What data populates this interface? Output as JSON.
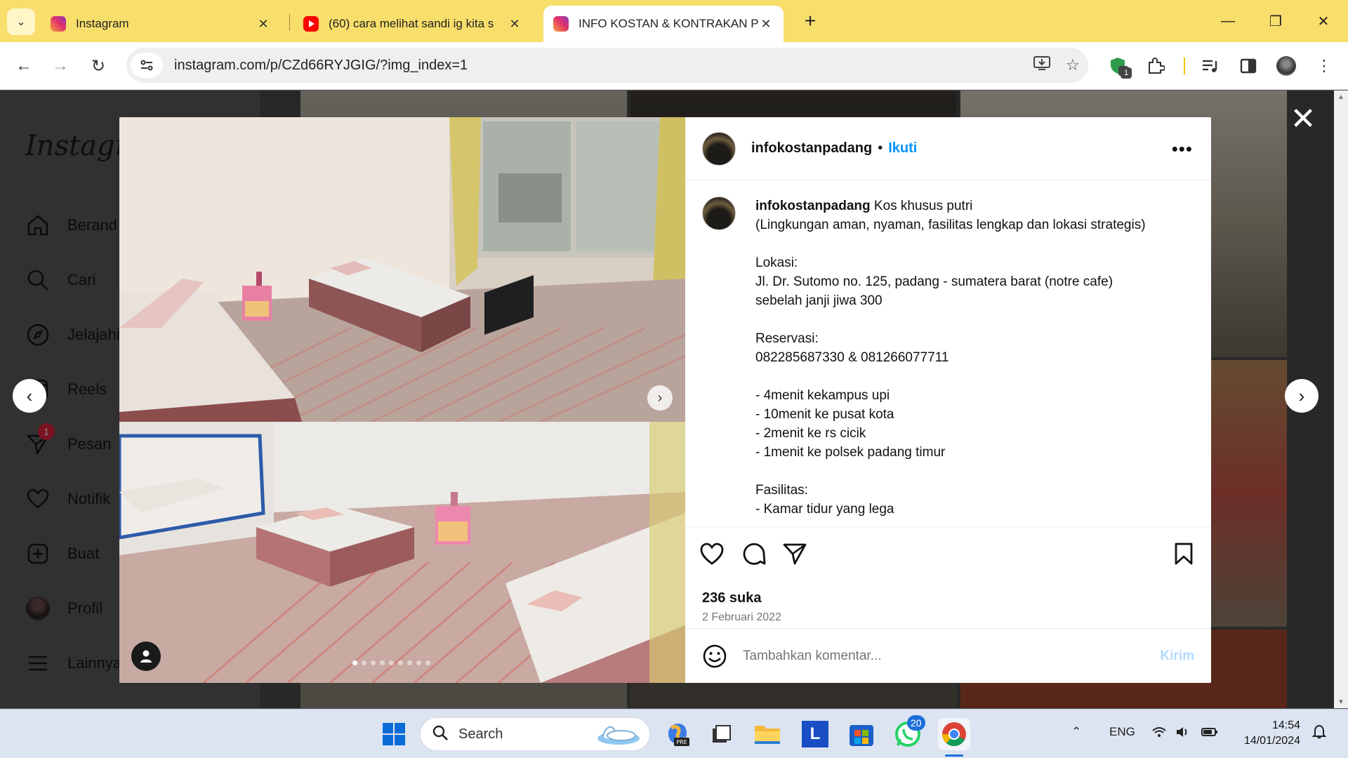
{
  "browser": {
    "tabs": [
      {
        "title": "Instagram",
        "favicon": "instagram-icon",
        "active": false
      },
      {
        "title": "(60) cara melihat sandi ig kita s",
        "favicon": "youtube-icon",
        "active": false
      },
      {
        "title": "INFO KOSTAN & KONTRAKAN P",
        "favicon": "instagram-icon",
        "active": true
      }
    ],
    "url": "instagram.com/p/CZd66RYJGIG/?img_index=1",
    "extension_badge": "1"
  },
  "instagram": {
    "logo": "Instagram",
    "nav": [
      {
        "label": "Berand",
        "icon": "home-icon"
      },
      {
        "label": "Cari",
        "icon": "search-icon"
      },
      {
        "label": "Jelajahi",
        "icon": "compass-icon"
      },
      {
        "label": "Reels",
        "icon": "reels-icon"
      },
      {
        "label": "Pesan",
        "icon": "messenger-icon",
        "badge": "1"
      },
      {
        "label": "Notifik",
        "icon": "heart-icon"
      },
      {
        "label": "Buat",
        "icon": "create-icon"
      },
      {
        "label": "Profil",
        "icon": "avatar"
      },
      {
        "label": "Lainnya",
        "icon": "menu-icon"
      }
    ]
  },
  "post": {
    "username": "infokostanpadang",
    "follow_label": "Ikuti",
    "caption_first": "Kos khusus putri",
    "caption_body": "(Lingkungan aman, nyaman, fasilitas lengkap dan lokasi strategis)\n\nLokasi:\nJl. Dr. Sutomo no. 125, padang - sumatera barat (notre cafe)\nsebelah janji jiwa 300\n\nReservasi:\n082285687330 & 081266077711\n\n- 4menit kekampus upi\n- 10menit ke pusat kota\n- 2menit ke rs cicik\n- 1menit ke polsek padang timur\n\nFasilitas:\n- Kamar tidur yang lega",
    "likes": "236 suka",
    "date": "2 Februari 2022",
    "comment_placeholder": "Tambahkan komentar...",
    "send_label": "Kirim",
    "carousel_dots": 9,
    "carousel_active": 0
  },
  "taskbar": {
    "search_label": "Search",
    "whatsapp_badge": "20",
    "language": "ENG",
    "time": "14:54",
    "date": "14/01/2024"
  }
}
